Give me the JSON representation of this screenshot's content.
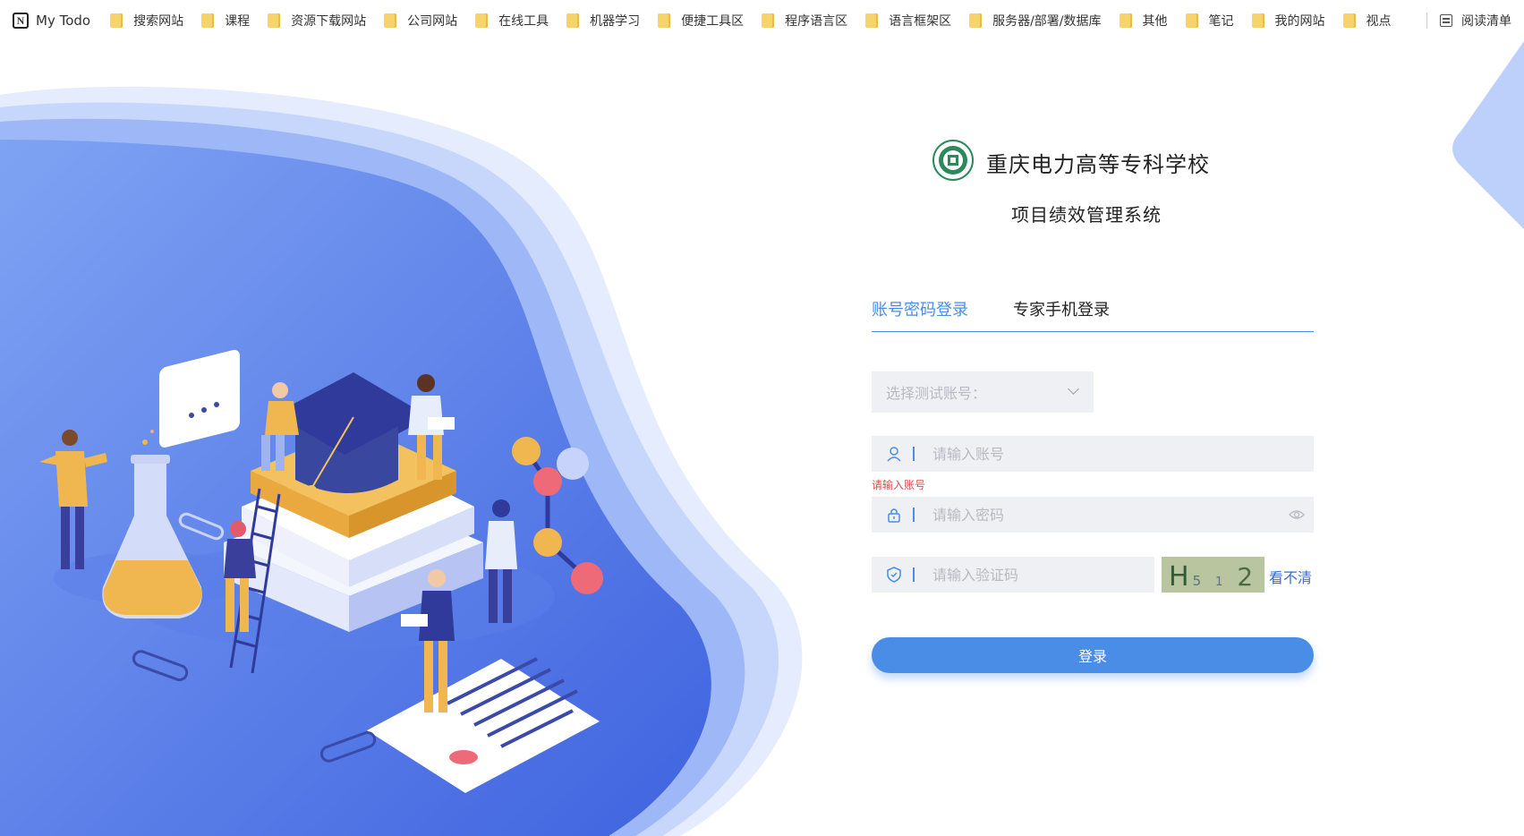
{
  "bookmarks": {
    "todo_label": "My Todo",
    "folders": [
      "搜索网站",
      "课程",
      "资源下载网站",
      "公司网站",
      "在线工具",
      "机器学习",
      "便捷工具区",
      "程序语言区",
      "语言框架区",
      "服务器/部署/数据库",
      "其他",
      "笔记",
      "我的网站",
      "视点"
    ],
    "reading_list": "阅读清单"
  },
  "header": {
    "school_name": "重庆电力高等专科学校",
    "system_name": "项目绩效管理系统"
  },
  "tabs": {
    "account": "账号密码登录",
    "phone": "专家手机登录"
  },
  "form": {
    "test_account_placeholder": "选择测试账号：",
    "account_placeholder": "请输入账号",
    "account_error": "请输入账号",
    "password_placeholder": "请输入密码",
    "captcha_placeholder": "请输入验证码",
    "captcha_text": "H5 1 2",
    "captcha_refresh": "看不清",
    "login_button": "登录"
  },
  "colors": {
    "primary": "#4a8de6",
    "error": "#e5484d",
    "field_bg": "#eef0f3"
  }
}
